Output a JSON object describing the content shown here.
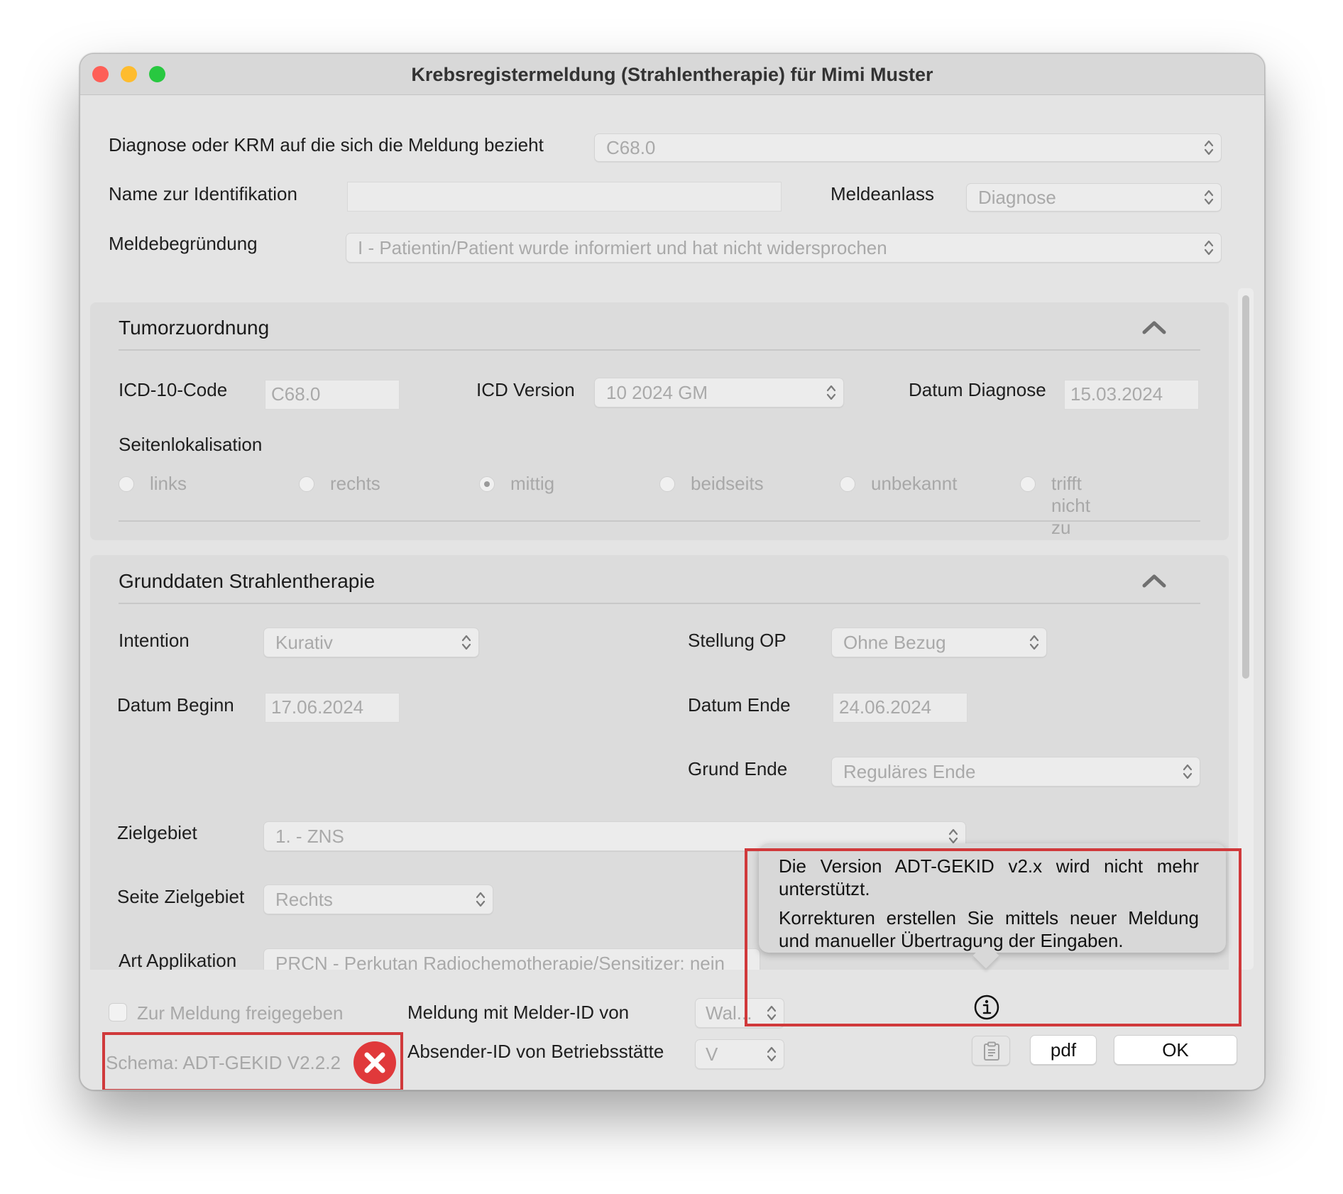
{
  "window": {
    "title": "Krebsregistermeldung (Strahlentherapie) für Mimi Muster"
  },
  "header": {
    "diagnose_label": "Diagnose oder KRM auf die sich die Meldung bezieht",
    "diagnose_value": "C68.0",
    "name_label": "Name zur Identifikation",
    "name_value": "",
    "meldeanlass_label": "Meldeanlass",
    "meldeanlass_value": "Diagnose",
    "meldebegruendung_label": "Meldebegründung",
    "meldebegruendung_value": "I - Patientin/Patient wurde informiert und hat nicht widersprochen"
  },
  "tumor": {
    "title": "Tumorzuordnung",
    "icd_code_label": "ICD-10-Code",
    "icd_code_value": "C68.0",
    "icd_version_label": "ICD Version",
    "icd_version_value": "10 2024 GM",
    "datum_diagnose_label": "Datum Diagnose",
    "datum_diagnose_value": "15.03.2024",
    "seiten_label": "Seitenlokalisation",
    "seiten_options": [
      "links",
      "rechts",
      "mittig",
      "beidseits",
      "unbekannt",
      "trifft nicht zu"
    ],
    "seiten_selected": "mittig"
  },
  "grunddaten": {
    "title": "Grunddaten Strahlentherapie",
    "intention_label": "Intention",
    "intention_value": "Kurativ",
    "stellung_label": "Stellung OP",
    "stellung_value": "Ohne Bezug",
    "datum_beginn_label": "Datum Beginn",
    "datum_beginn_value": "17.06.2024",
    "datum_ende_label": "Datum Ende",
    "datum_ende_value": "24.06.2024",
    "grund_ende_label": "Grund Ende",
    "grund_ende_value": "Reguläres Ende",
    "zielgebiet_label": "Zielgebiet",
    "zielgebiet_value": "1. - ZNS",
    "seite_ziel_label": "Seite Zielgebiet",
    "seite_ziel_value": "Rechts",
    "art_label": "Art Applikation",
    "art_value": "PRCN - Perkutan Radiochemotherapie/Sensitizer: nein"
  },
  "tooltip": {
    "line1": "Die Version ADT-GEKID v2.x wird nicht mehr unterstützt.",
    "line2": "Korrekturen erstellen Sie mittels neuer Meldung und manueller Übertragung der Eingaben."
  },
  "footer": {
    "freigegeben_label": "Zur Meldung freigegeben",
    "schema_text": "Schema: ADT-GEKID V2.2.2",
    "melder_label": "Meldung mit Melder-ID von",
    "melder_value": "Wal...",
    "absender_label": "Absender-ID von Betriebsstätte",
    "absender_value": "V",
    "pdf_label": "pdf",
    "ok_label": "OK"
  },
  "colors": {
    "error_red": "#e0393b",
    "highlight_red": "#d0393b",
    "close": "#fe5f57",
    "minimize": "#febc2e",
    "zoom": "#28c840"
  },
  "icons": [
    "stepper-icon",
    "chevron-up-icon",
    "info-icon",
    "clipboard-icon",
    "error-x-icon"
  ]
}
